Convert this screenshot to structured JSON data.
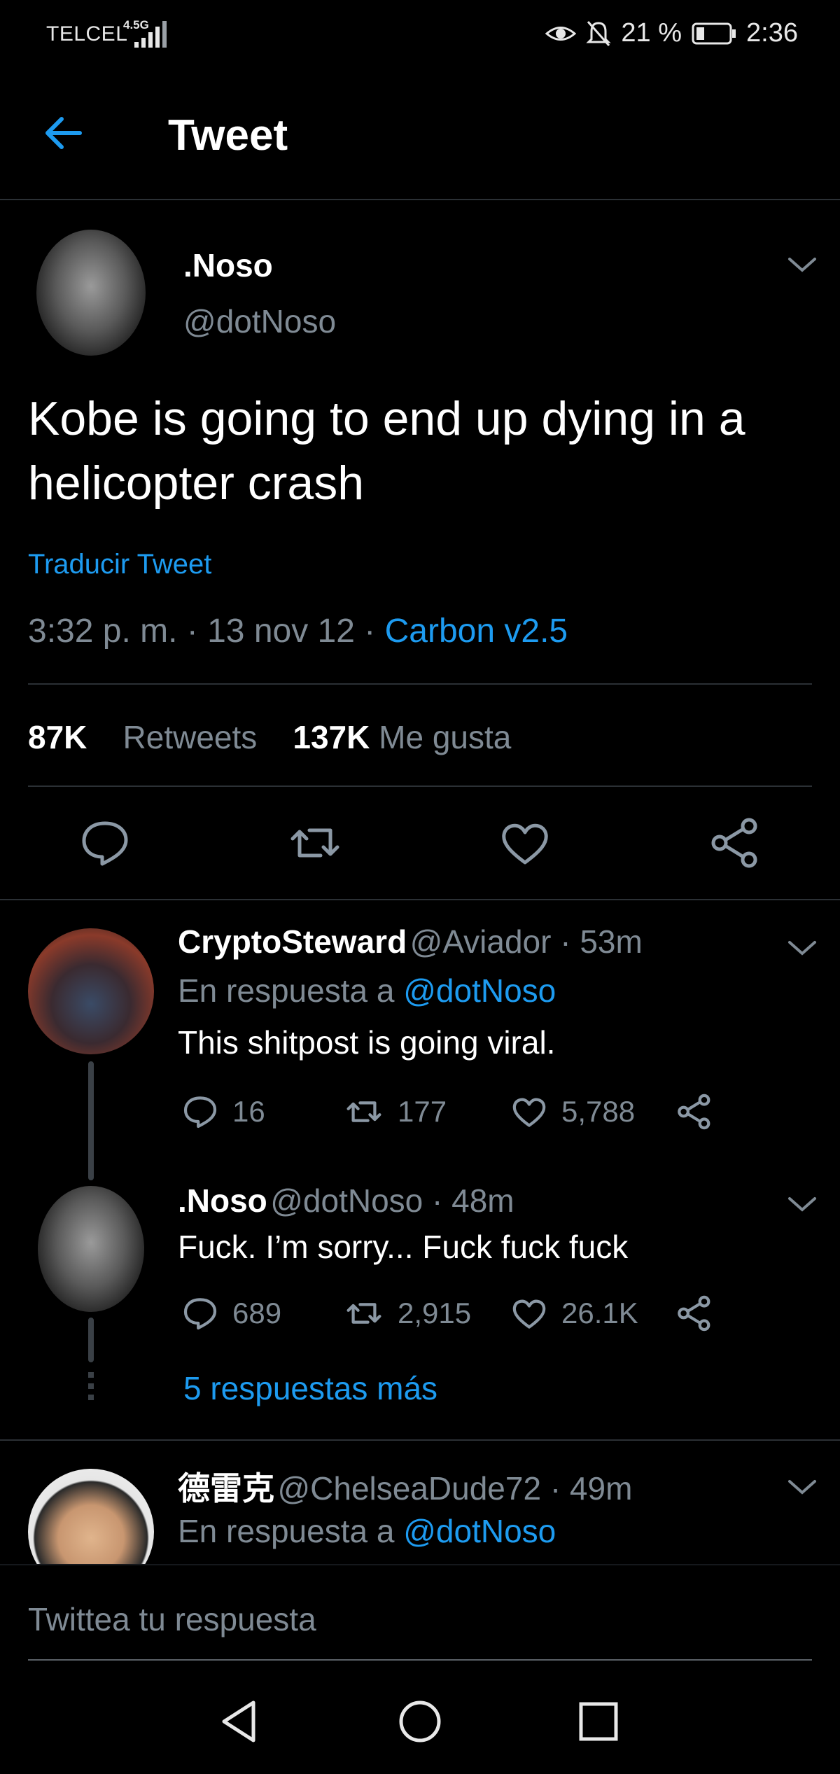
{
  "status_bar": {
    "carrier": "TELCEL",
    "network": "4.5G",
    "battery": "21 %",
    "time": "2:36",
    "icons": [
      "signal-icon",
      "eye-icon",
      "bell-off-icon",
      "battery-icon"
    ]
  },
  "header": {
    "title": "Tweet",
    "back_icon": "arrow-left-icon"
  },
  "main_tweet": {
    "name": ".Noso",
    "handle": "@dotNoso",
    "text": "Kobe is going to end up dying in a helicopter crash",
    "translate": "Traducir Tweet",
    "timestamp": "3:32 p. m. · 13 nov 12 · ",
    "source": "Carbon v2.5",
    "retweets_count": "87K",
    "retweets_label": "Retweets",
    "likes_count": "137K",
    "likes_label": "Me gusta"
  },
  "replies": [
    {
      "name": "CryptoSteward",
      "handle": "@Aviador · 53m",
      "reply_prefix": "En respuesta a ",
      "reply_to": "@dotNoso",
      "text": "This shitpost is going viral.",
      "reply_count": "16",
      "retweet_count": "177",
      "like_count": "5,788"
    },
    {
      "name": ".Noso",
      "handle": "@dotNoso · 48m",
      "text": "Fuck. I’m sorry... Fuck fuck fuck",
      "reply_count": "689",
      "retweet_count": "2,915",
      "like_count": "26.1K",
      "more_replies": "5 respuestas más"
    },
    {
      "name": "德雷克",
      "handle": "@ChelseaDude72 · 49m",
      "reply_prefix": "En respuesta a ",
      "reply_to": "@dotNoso"
    }
  ],
  "compose": {
    "placeholder": "Twittea tu respuesta"
  },
  "colors": {
    "accent": "#1d9bf0",
    "background": "#000000",
    "muted": "#7f8a94",
    "divider": "#2b3035"
  }
}
